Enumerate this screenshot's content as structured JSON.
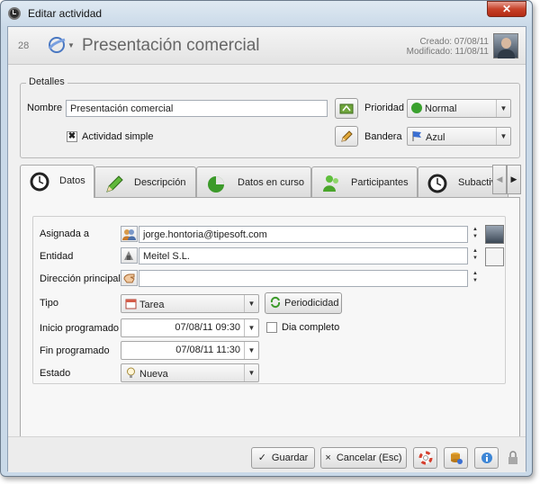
{
  "window": {
    "title": "Editar actividad",
    "close_label": "✕"
  },
  "header": {
    "number": "28",
    "title": "Presentación comercial",
    "created": "Creado: 07/08/11",
    "modified": "Modificado: 11/08/11"
  },
  "details": {
    "legend": "Detalles",
    "nombre_label": "Nombre",
    "nombre_value": "Presentación comercial",
    "simple_label": "Actividad simple",
    "simple_checked": true,
    "prioridad_label": "Prioridad",
    "prioridad_value": "Normal",
    "bandera_label": "Bandera",
    "bandera_value": "Azul"
  },
  "tabs": [
    {
      "label": "Datos",
      "active": true
    },
    {
      "label": "Descripción",
      "active": false
    },
    {
      "label": "Datos en curso",
      "active": false
    },
    {
      "label": "Participantes",
      "active": false
    },
    {
      "label": "Subactiv",
      "active": false
    }
  ],
  "form": {
    "asignada_label": "Asignada a",
    "asignada_value": "jorge.hontoria@tipesoft.com",
    "entidad_label": "Entidad",
    "entidad_value": "Meitel S.L.",
    "direccion_label": "Dirección principal",
    "direccion_value": "",
    "tipo_label": "Tipo",
    "tipo_value": "Tarea",
    "periodicidad_label": "Periodicidad",
    "inicio_label": "Inicio programado",
    "inicio_value": "07/08/11 09:30",
    "dia_completo_label": "Dia completo",
    "dia_completo_checked": false,
    "fin_label": "Fin programado",
    "fin_value": "07/08/11 11:30",
    "estado_label": "Estado",
    "estado_value": "Nueva"
  },
  "footer": {
    "guardar_label": "Guardar",
    "cancelar_label": "Cancelar (Esc)"
  },
  "colors": {
    "priority_dot": "#3aa12e",
    "flag": "#3b6fd1",
    "close_button": "#c7422a"
  }
}
